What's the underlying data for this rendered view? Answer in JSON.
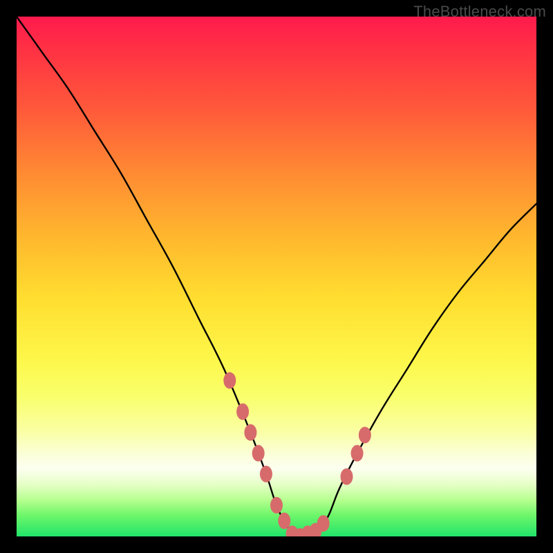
{
  "watermark": "TheBottleneck.com",
  "chart_data": {
    "type": "line",
    "title": "",
    "xlabel": "",
    "ylabel": "",
    "xlim": [
      0,
      100
    ],
    "ylim": [
      0,
      100
    ],
    "series": [
      {
        "name": "bottleneck-curve",
        "x": [
          0,
          5,
          10,
          15,
          20,
          25,
          30,
          35,
          40,
          45,
          48,
          50,
          52,
          54,
          56,
          58,
          60,
          62,
          65,
          70,
          75,
          80,
          85,
          90,
          95,
          100
        ],
        "y": [
          100,
          93,
          86,
          78,
          70,
          61,
          52,
          42,
          32,
          20,
          12,
          6,
          2,
          0,
          0,
          1,
          4,
          9,
          15,
          24,
          32,
          40,
          47,
          53,
          59,
          64
        ]
      }
    ],
    "markers": {
      "name": "highlighted-points",
      "color": "#d76b6b",
      "points": [
        {
          "x": 41.0,
          "y": 30.0
        },
        {
          "x": 43.5,
          "y": 24.0
        },
        {
          "x": 45.0,
          "y": 20.0
        },
        {
          "x": 46.5,
          "y": 16.0
        },
        {
          "x": 48.0,
          "y": 12.0
        },
        {
          "x": 50.0,
          "y": 6.0
        },
        {
          "x": 51.5,
          "y": 3.0
        },
        {
          "x": 53.0,
          "y": 0.5
        },
        {
          "x": 54.5,
          "y": 0.0
        },
        {
          "x": 56.0,
          "y": 0.5
        },
        {
          "x": 57.5,
          "y": 1.0
        },
        {
          "x": 59.0,
          "y": 2.5
        },
        {
          "x": 63.5,
          "y": 11.5
        },
        {
          "x": 65.5,
          "y": 16.0
        },
        {
          "x": 67.0,
          "y": 19.5
        }
      ]
    }
  }
}
